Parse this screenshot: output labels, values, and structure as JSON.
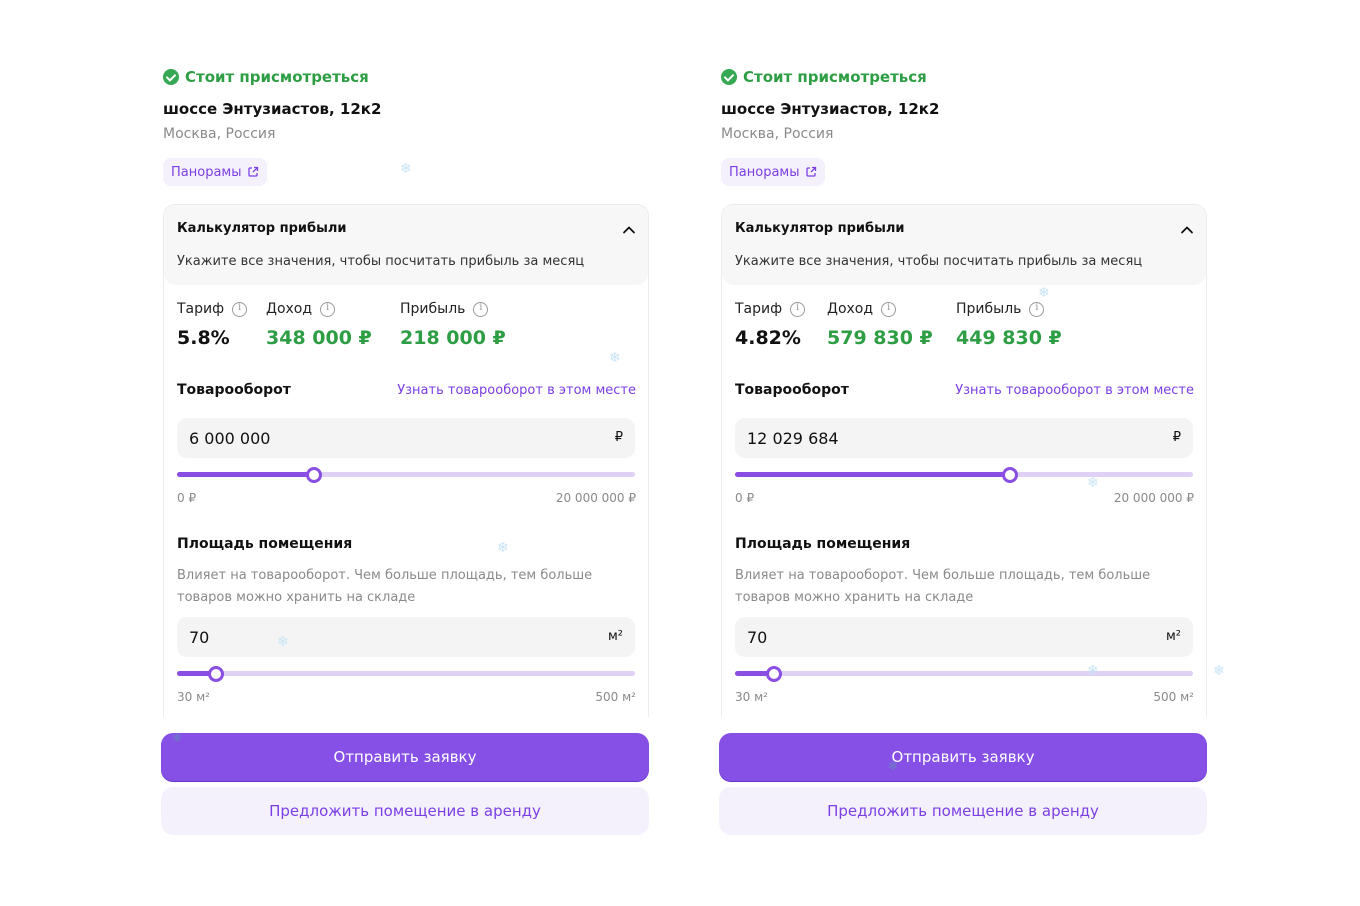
{
  "cards": [
    {
      "status": "Стоит присмотреться",
      "address": "шоссе Энтузиастов, 12к2",
      "city": "Москва, Россия",
      "panoramas": "Панорамы",
      "calc_title": "Калькулятор прибыли",
      "calc_subtitle": "Укажите все значения, чтобы посчитать прибыль за месяц",
      "metrics": {
        "tariff_label": "Тариф",
        "tariff_value": "5.8%",
        "income_label": "Доход",
        "income_value": "348 000 ₽",
        "profit_label": "Прибыль",
        "profit_value": "218 000 ₽"
      },
      "turnover_label": "Товарооборот",
      "turnover_link": "Узнать товарооборот в этом месте",
      "turnover_value": "6 000 000",
      "turnover_unit": "₽",
      "turnover_min": "0 ₽",
      "turnover_max": "20 000 000 ₽",
      "turnover_fraction": 0.3,
      "area_label": "Площадь помещения",
      "area_desc": "Влияет на товарооборот. Чем больше площадь, тем больше товаров можно хранить на складе",
      "area_value": "70",
      "area_unit": "м²",
      "area_min": "30 м²",
      "area_max": "500 м²",
      "area_fraction": 0.085,
      "submit": "Отправить заявку",
      "offer": "Предложить помещение в аренду"
    },
    {
      "status": "Стоит присмотреться",
      "address": "шоссе Энтузиастов, 12к2",
      "city": "Москва, Россия",
      "panoramas": "Панорамы",
      "calc_title": "Калькулятор прибыли",
      "calc_subtitle": "Укажите все значения, чтобы посчитать прибыль за месяц",
      "metrics": {
        "tariff_label": "Тариф",
        "tariff_value": "4.82%",
        "income_label": "Доход",
        "income_value": "579 830 ₽",
        "profit_label": "Прибыль",
        "profit_value": "449 830 ₽"
      },
      "turnover_label": "Товарооборот",
      "turnover_link": "Узнать товарооборот в этом месте",
      "turnover_value": "12 029 684",
      "turnover_unit": "₽",
      "turnover_min": "0 ₽",
      "turnover_max": "20 000 000 ₽",
      "turnover_fraction": 0.6,
      "area_label": "Площадь помещения",
      "area_desc": "Влияет на товарооборот. Чем больше площадь, тем больше товаров можно хранить на складе",
      "area_value": "70",
      "area_unit": "м²",
      "area_min": "30 м²",
      "area_max": "500 м²",
      "area_fraction": 0.085,
      "submit": "Отправить заявку",
      "offer": "Предложить помещение в аренду"
    }
  ],
  "colors": {
    "accent": "#8650e6",
    "success": "#2e9e44",
    "muted": "#8a8a8a"
  }
}
